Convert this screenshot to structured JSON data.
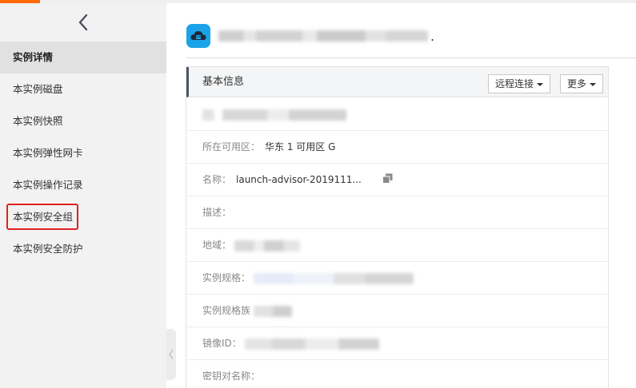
{
  "sidebar": {
    "items": [
      {
        "label": "实例详情",
        "active": true
      },
      {
        "label": "本实例磁盘"
      },
      {
        "label": "本实例快照"
      },
      {
        "label": "本实例弹性网卡"
      },
      {
        "label": "本实例操作记录"
      },
      {
        "label": "本实例安全组",
        "highlighted": true
      },
      {
        "label": "本实例安全防护"
      }
    ]
  },
  "header": {
    "title_suffix": ".",
    "icon": "cloud-server-icon"
  },
  "panel": {
    "title": "基本信息",
    "remote_connect_label": "远程连接",
    "more_label": "更多",
    "rows": {
      "zone_label": "所在可用区：",
      "zone_value": "华东 1 可用区 G",
      "name_label": "名称：",
      "name_value": "launch-advisor-2019111...",
      "desc_label": "描述：",
      "region_label": "地域：",
      "spec_label": "实例规格：",
      "spec_family_label": "实例规格族",
      "image_label": "镜像ID：",
      "keypair_label": "密钥对名称："
    }
  },
  "colors": {
    "accent": "#ff6a00",
    "icon_bg": "#1aa3e8",
    "highlight": "#e02020"
  }
}
